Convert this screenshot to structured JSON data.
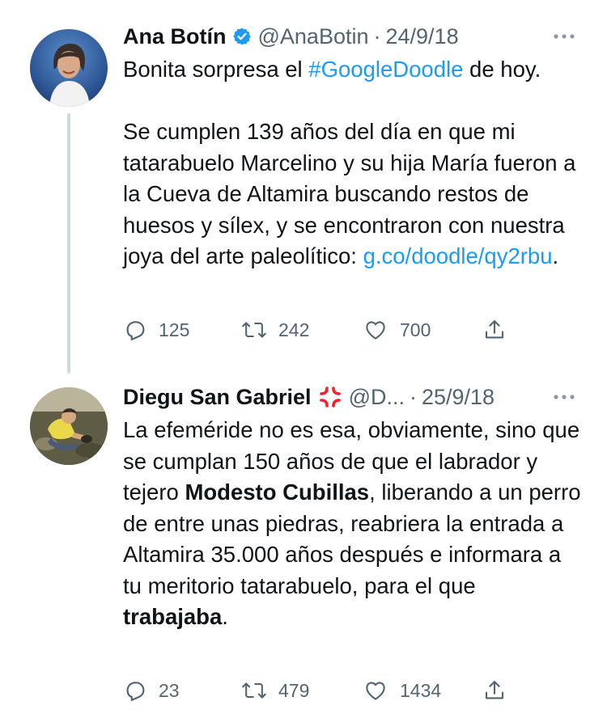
{
  "tweets": [
    {
      "author": {
        "name": "Ana Botín",
        "handle": "@AnaBotin",
        "verified": true
      },
      "date": "24/9/18",
      "separator": "·",
      "body": {
        "p1_before": "Bonita sorpresa el ",
        "p1_hashtag": "#GoogleDoodle",
        "p1_after": " de hoy.",
        "p2_text": "Se cumplen 139 años del día en que mi tatarabuelo Marcelino y su hija María fueron a la Cueva de Altamira buscando restos de huesos y sílex, y se encontraron con nuestra joya del arte paleolítico: ",
        "p2_link": "g.co/doodle/qy2rbu",
        "p2_after": "."
      },
      "stats": {
        "replies": "125",
        "retweets": "242",
        "likes": "700"
      }
    },
    {
      "author": {
        "name": "Diegu San Gabriel",
        "handle": "@D...",
        "verified": false,
        "emoji": "anger-symbol"
      },
      "date": "25/9/18",
      "separator": "·",
      "body": {
        "t1": "La efeméride no es esa, obviamente, sino que se cumplan 150 años de que el labrador y tejero ",
        "b1": "Modesto Cubillas",
        "t2": ", liberando a un perro de entre unas piedras, reabriera la entrada a Altamira 35.000 años después e informara a tu meritorio tatarabuelo, para el que ",
        "b2": "trabajaba",
        "t3": "."
      },
      "stats": {
        "replies": "23",
        "retweets": "479",
        "likes": "1434"
      }
    }
  ],
  "colors": {
    "link": "#1d9bf0",
    "secondary": "#536471",
    "verified": "#1d9bf0",
    "thread_line": "#cfd9de",
    "anger": "#f4212e"
  },
  "icons": [
    "verified-badge-icon",
    "more-icon",
    "reply-icon",
    "retweet-icon",
    "like-icon",
    "share-icon",
    "anger-symbol-icon"
  ]
}
